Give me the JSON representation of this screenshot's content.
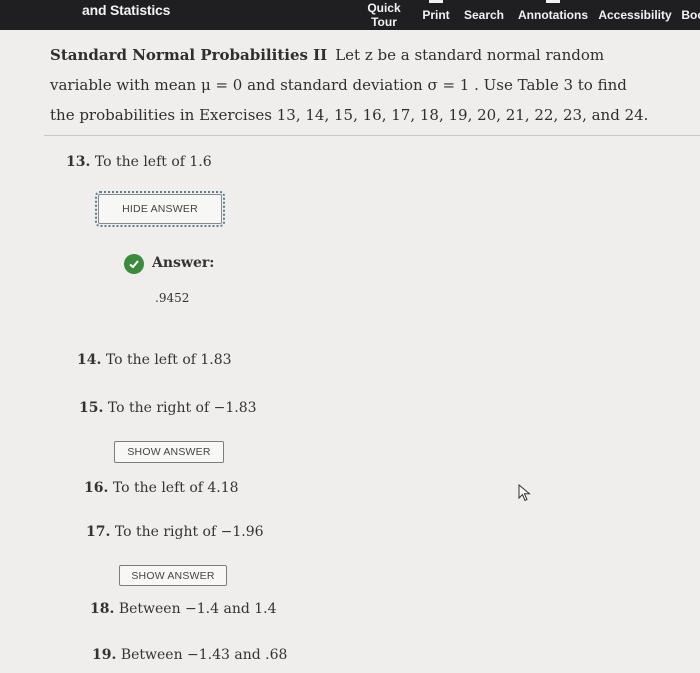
{
  "topbar": {
    "title": "and Statistics",
    "nav": {
      "quick_tour_line1": "Quick",
      "quick_tour_line2": "Tour",
      "print": "Print",
      "search": "Search",
      "annotations": "Annotations",
      "accessibility": "Accessibility",
      "book": "Boo"
    }
  },
  "intro": {
    "heading": "Standard Normal Probabilities II",
    "text": "Let z be a standard normal random variable with mean μ = 0 and standard deviation σ = 1 . Use Table 3 to find the probabilities in Exercises 13, 14, 15, 16, 17, 18, 19, 20, 21, 22, 23, and 24."
  },
  "exercises": [
    {
      "num": "13.",
      "text": "To the left of 1.6"
    },
    {
      "num": "14.",
      "text": "To the left of 1.83"
    },
    {
      "num": "15.",
      "text": "To the right of −1.83"
    },
    {
      "num": "16.",
      "text": "To the left of 4.18"
    },
    {
      "num": "17.",
      "text": "To the right of −1.96"
    },
    {
      "num": "18.",
      "text": "Between −1.4 and 1.4"
    },
    {
      "num": "19.",
      "text": "Between −1.43 and .68"
    }
  ],
  "buttons": {
    "hide_answer": "HIDE ANSWER",
    "show_answer": "SHOW ANSWER"
  },
  "answer": {
    "label": "Answer:",
    "value": ".9452"
  },
  "colors": {
    "topbar": "#1f1f22",
    "check": "#3d8a3f",
    "focus_outline": "#5d7f93"
  }
}
